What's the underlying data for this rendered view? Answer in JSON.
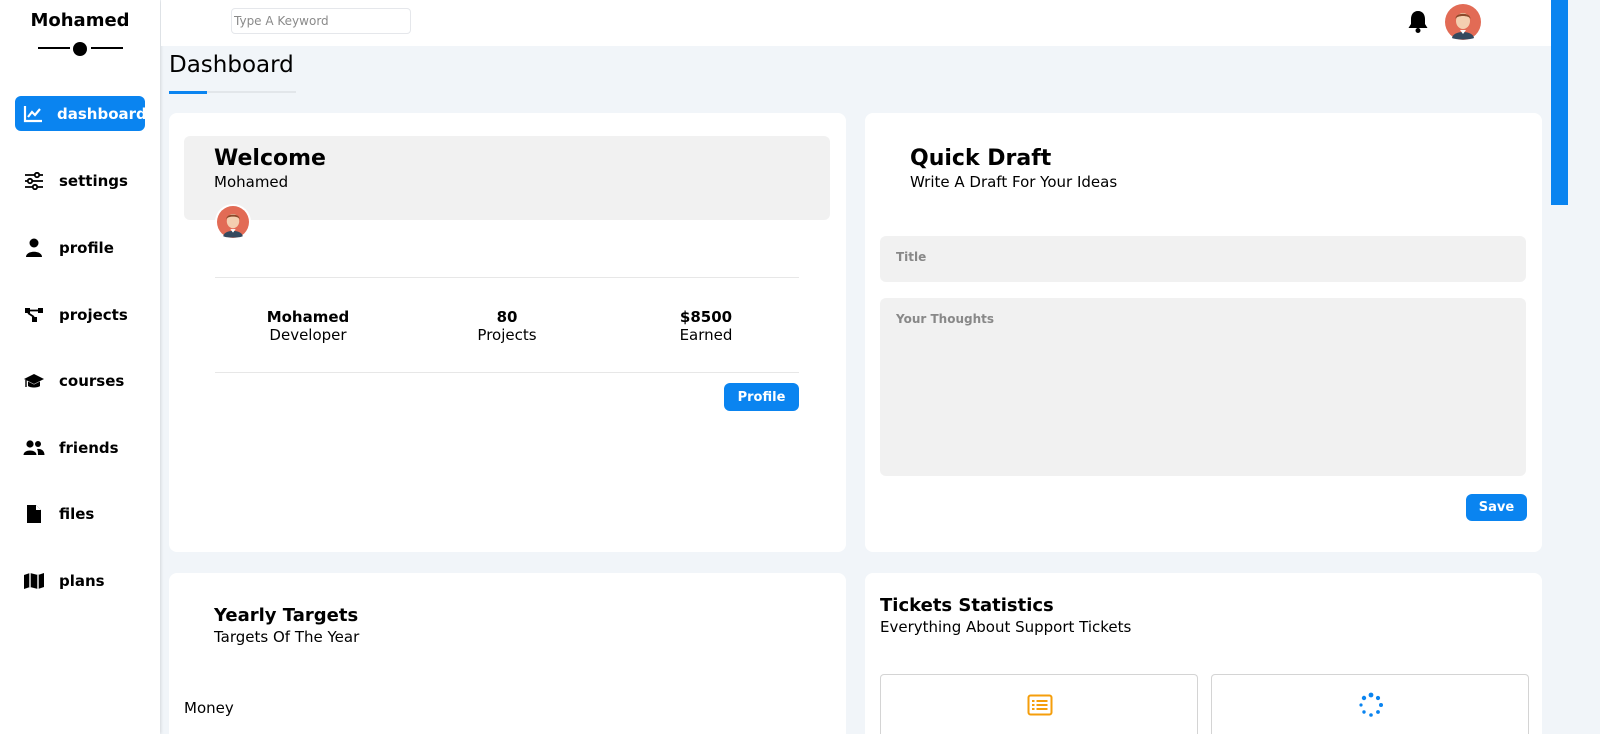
{
  "sidebar": {
    "brand": "Mohamed",
    "items": [
      {
        "label": "dashboard",
        "icon": "chart-line-icon",
        "active": true
      },
      {
        "label": "settings",
        "icon": "sliders-icon",
        "active": false
      },
      {
        "label": "profile",
        "icon": "user-icon",
        "active": false
      },
      {
        "label": "projects",
        "icon": "diagram-project-icon",
        "active": false
      },
      {
        "label": "courses",
        "icon": "graduation-cap-icon",
        "active": false
      },
      {
        "label": "friends",
        "icon": "users-icon",
        "active": false
      },
      {
        "label": "files",
        "icon": "file-icon",
        "active": false
      },
      {
        "label": "plans",
        "icon": "map-icon",
        "active": false
      }
    ]
  },
  "header": {
    "search_placeholder": "Type A Keyword",
    "bell_icon": "bell-icon",
    "avatar_icon": "user-avatar-icon"
  },
  "page": {
    "title": "Dashboard"
  },
  "welcome": {
    "title": "Welcome",
    "name": "Mohamed",
    "stats": [
      {
        "value": "Mohamed",
        "label": "Developer"
      },
      {
        "value": "80",
        "label": "Projects"
      },
      {
        "value": "$8500",
        "label": "Earned"
      }
    ],
    "button": "Profile"
  },
  "quick_draft": {
    "title": "Quick Draft",
    "subtitle": "Write A Draft For Your Ideas",
    "title_placeholder": "Title",
    "body_placeholder": "Your Thoughts",
    "button": "Save"
  },
  "yearly_targets": {
    "title": "Yearly Targets",
    "subtitle": "Targets Of The Year",
    "first_label": "Money"
  },
  "tickets": {
    "title": "Tickets Statistics",
    "subtitle": "Everything About Support Tickets",
    "box_icons": [
      "list-icon",
      "spinner-icon"
    ]
  },
  "colors": {
    "accent": "#0a84f0",
    "ticket_orange": "#f59e0b",
    "background": "#f1f5f9"
  }
}
